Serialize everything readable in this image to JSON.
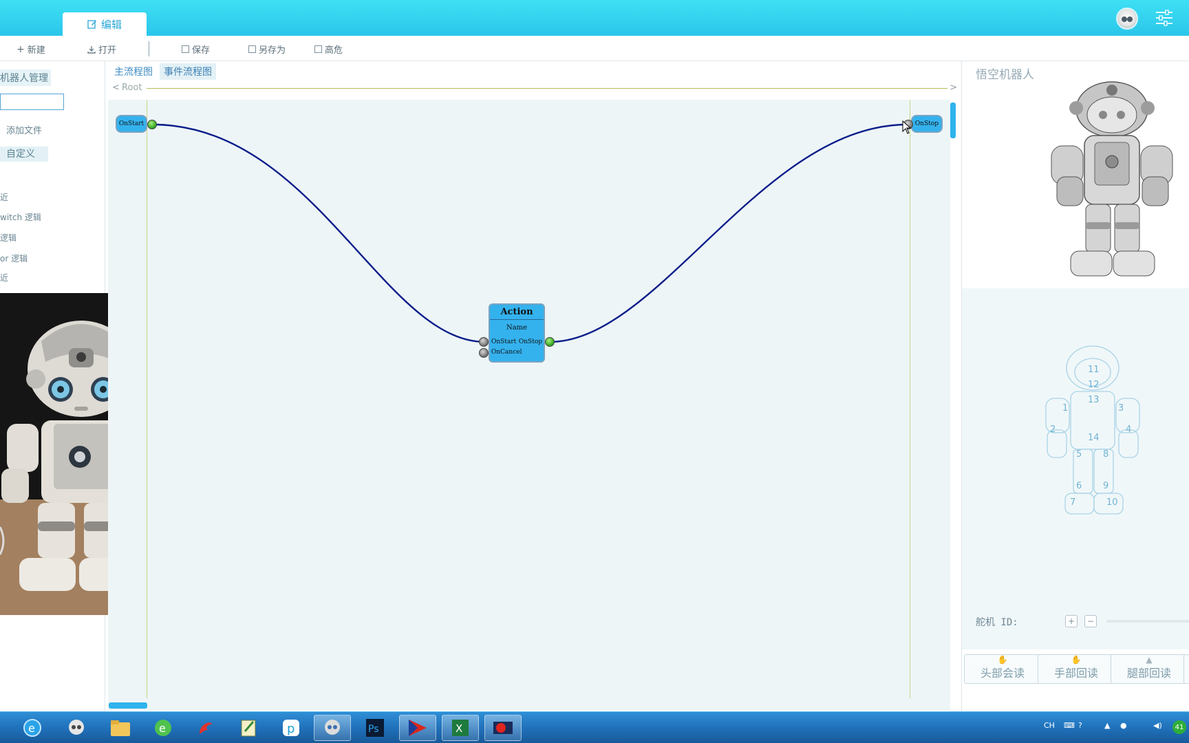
{
  "top_tab": {
    "label": "编辑"
  },
  "toolbar": {
    "new_label": "新建",
    "open_label": "打开",
    "save_label": "保存",
    "save_as_label": "另存为",
    "high_risk_label": "高危"
  },
  "left_panel": {
    "robot_mgmt": "机器人管理",
    "add_file": "添加文件",
    "custom": "自定义",
    "items": [
      "近",
      "witch 逻辑",
      "逻辑",
      "or 逻辑",
      "近"
    ]
  },
  "flow_tabs": [
    {
      "label": "主流程图"
    },
    {
      "label": "事件流程图"
    }
  ],
  "breadcrumb": {
    "back": "<",
    "root": "Root",
    "forward": ">"
  },
  "nodes": {
    "start": {
      "label": "OnStart"
    },
    "stop": {
      "label": "OnStop"
    },
    "action": {
      "title": "Action",
      "name": "Name",
      "in_start": "OnStart",
      "out_stop": "OnStop",
      "in_cancel": "OnCancel"
    }
  },
  "right_panel": {
    "title": "悟空机器人",
    "servo_numbers": [
      "11",
      "12",
      "13",
      "1",
      "3",
      "2",
      "4",
      "14",
      "5",
      "8",
      "6",
      "9",
      "7",
      "10"
    ],
    "servo_id_label": "舵机 ID:",
    "plus_label": "+",
    "minus_label": "−",
    "readback_buttons": [
      {
        "label": "头部会读"
      },
      {
        "label": "手部回读"
      },
      {
        "label": "腿部回读"
      }
    ]
  },
  "taskbar": {
    "tray_lang": "CH",
    "tray_clock": "41",
    "apps": [
      "ie-icon",
      "robot-icon",
      "folder-icon",
      "browser-icon",
      "foxit-icon",
      "notepad-icon",
      "p-icon",
      "robot-app-icon",
      "photoshop-icon",
      "player-icon",
      "excel-icon",
      "recorder-icon"
    ]
  },
  "colors": {
    "accent": "#2bc6ea",
    "node_fill": "#34b2ee",
    "wire": "#0a1e8a",
    "taskbar": "#1f6fb8"
  }
}
